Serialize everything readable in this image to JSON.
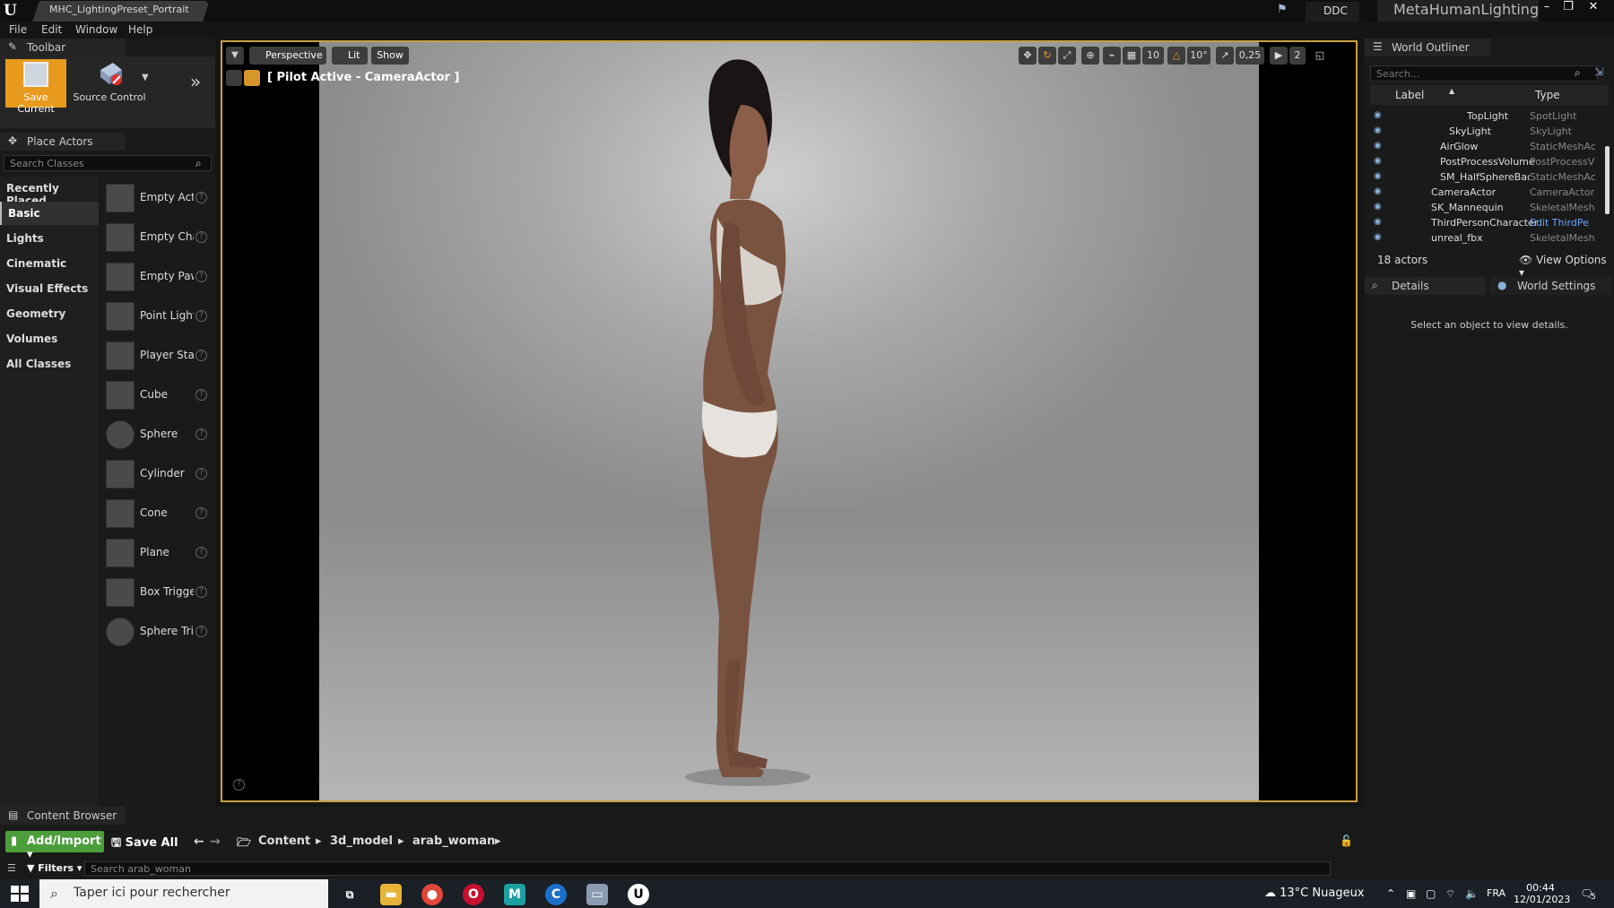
{
  "title_bar": {
    "doc_tab": "MHC_LightingPreset_Portrait",
    "ddc": "DDC",
    "project_name": "MetaHumanLighting",
    "window_controls": [
      "–",
      "❐",
      "✕"
    ]
  },
  "menu": [
    "File",
    "Edit",
    "Window",
    "Help"
  ],
  "toolbar": {
    "tab": "Toolbar",
    "save_label": "Save Current",
    "source_label": "Source Control"
  },
  "place_actors": {
    "tab": "Place Actors",
    "search_placeholder": "Search Classes",
    "categories": [
      "Recently Placed",
      "Basic",
      "Lights",
      "Cinematic",
      "Visual Effects",
      "Geometry",
      "Volumes",
      "All Classes"
    ],
    "selected_category": "Basic",
    "items": [
      "Empty Actor",
      "Empty Character",
      "Empty Pawn",
      "Point Light",
      "Player Start",
      "Cube",
      "Sphere",
      "Cylinder",
      "Cone",
      "Plane",
      "Box Trigger",
      "Sphere Trigger"
    ]
  },
  "viewport": {
    "view_mode": "Perspective",
    "lit": "Lit",
    "show": "Show",
    "pilot_label": "[ Pilot Active - CameraActor ]",
    "grid_snap": "10",
    "rot_snap": "10°",
    "scale_snap": "0,25",
    "cam_speed": "2"
  },
  "outliner": {
    "tab": "World Outliner",
    "search_placeholder": "Search...",
    "col_label": "Label",
    "col_type": "Type",
    "rows": [
      {
        "label": "TopLight",
        "type": "SpotLight"
      },
      {
        "label": "SkyLight",
        "type": "SkyLight"
      },
      {
        "label": "AirGlow",
        "type": "StaticMeshAc"
      },
      {
        "label": "PostProcessVolume",
        "type": "PostProcessV"
      },
      {
        "label": "SM_HalfSphereBackg",
        "type": "StaticMeshAc"
      },
      {
        "label": "CameraActor",
        "type": "CameraActor"
      },
      {
        "label": "SK_Mannequin",
        "type": "SkeletalMesh"
      },
      {
        "label": "ThirdPersonCharacter",
        "type": "Edit ThirdPe"
      },
      {
        "label": "unreal_fbx",
        "type": "SkeletalMesh"
      }
    ],
    "actor_count": "18 actors",
    "view_options": "View Options"
  },
  "details": {
    "tab": "Details",
    "world_settings_tab": "World Settings",
    "empty_msg": "Select an object to view details."
  },
  "content_browser": {
    "tab": "Content Browser",
    "add_import": "Add/Import",
    "save_all": "Save All",
    "path": [
      "Content",
      "3d_model",
      "arab_woman"
    ],
    "filters": "Filters",
    "search_placeholder": "Search arab_woman"
  },
  "taskbar": {
    "search_placeholder": "Taper ici pour rechercher",
    "weather": "13°C  Nuageux",
    "lang": "FRA",
    "time": "00:44",
    "date": "12/01/2023",
    "notif_count": "5"
  },
  "colors": {
    "accent": "#e79a1c",
    "add_import": "#4b9e3a",
    "viewport_border": "#c8a040",
    "link": "#6aa6ff"
  }
}
